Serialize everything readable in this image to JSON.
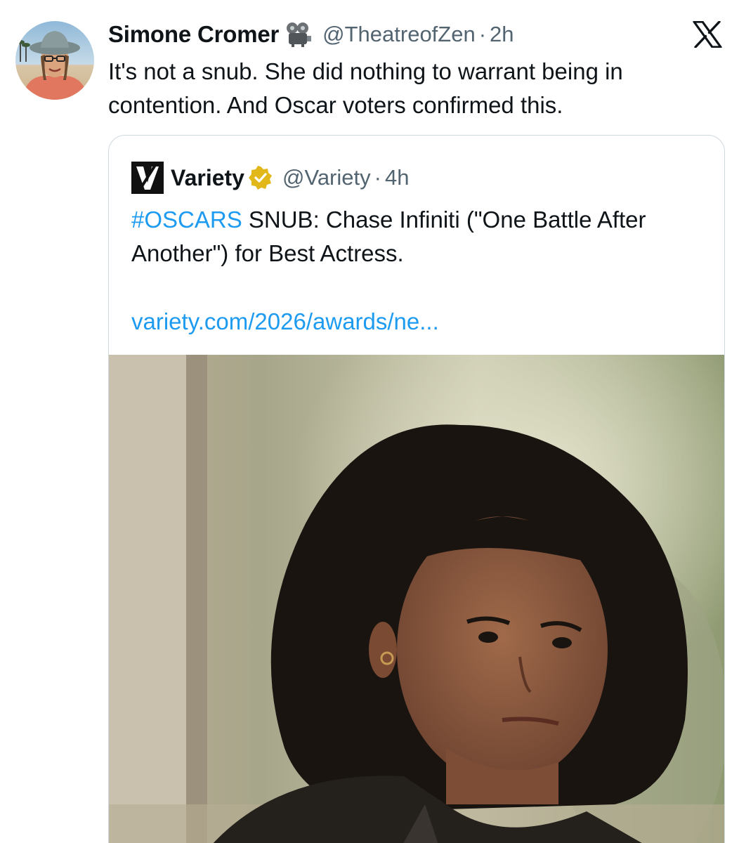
{
  "tweet": {
    "display_name": "Simone Cromer",
    "name_emoji_icon": "film-projector-icon",
    "handle": "@TheatreofZen",
    "separator": "·",
    "time": "2h",
    "text": "It's not a snub. She did nothing to warrant being in contention. And Oscar voters confirmed this."
  },
  "app": {
    "logo_icon": "x-logo-icon"
  },
  "quote": {
    "display_name": "Variety",
    "logo_icon": "variety-logo-icon",
    "verified_icon": "gold-verified-badge-icon",
    "handle": "@Variety",
    "separator": "·",
    "time": "4h",
    "hashtag": "#OSCARS",
    "text": " SNUB: Chase Infiniti (\"One Battle After Another\") for Best Actress.",
    "link": "variety.com/2026/awards/ne..."
  },
  "colors": {
    "link_blue": "#1d9bf0",
    "secondary_text": "#536471",
    "primary_text": "#0f1419",
    "border": "#cfd9de",
    "verified_gold": "#e2b719"
  }
}
